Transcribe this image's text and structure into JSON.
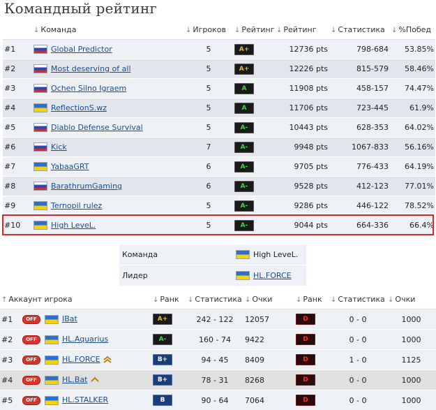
{
  "page": {
    "title": "Командный рейтинг"
  },
  "team_table": {
    "headers": {
      "team": "Команда",
      "players": "Игроков",
      "rating_badge": "Рейтинг",
      "rating": "Рейтинг",
      "stats": "Статистика",
      "win_pct": "%Побед"
    },
    "rows": [
      {
        "rank": "#1",
        "flag": "ru",
        "name": "Global Predictor",
        "players": "5",
        "badge": "A+",
        "badge_color": "gold",
        "rating": "12736 pts",
        "stats": "798-684",
        "win": "53.85%"
      },
      {
        "rank": "#2",
        "flag": "ru",
        "name": "Most deserving of all",
        "players": "5",
        "badge": "A+",
        "badge_color": "gold",
        "rating": "12226 pts",
        "stats": "815-579",
        "win": "58.46%"
      },
      {
        "rank": "#3",
        "flag": "ru",
        "name": "Ochen Silno Igraem",
        "players": "5",
        "badge": "A",
        "badge_color": "green",
        "rating": "11908 pts",
        "stats": "458-157",
        "win": "74.47%"
      },
      {
        "rank": "#4",
        "flag": "ua",
        "name": "ReflectionS.wz",
        "players": "5",
        "badge": "A",
        "badge_color": "green",
        "rating": "11706 pts",
        "stats": "723-445",
        "win": "61.9%"
      },
      {
        "rank": "#5",
        "flag": "ru",
        "name": "Diablo Defense Survival",
        "players": "5",
        "badge": "A-",
        "badge_color": "green",
        "rating": "10443 pts",
        "stats": "628-353",
        "win": "64.02%"
      },
      {
        "rank": "#6",
        "flag": "ru",
        "name": "Kick",
        "players": "7",
        "badge": "A-",
        "badge_color": "green",
        "rating": "9948 pts",
        "stats": "1067-833",
        "win": "56.16%"
      },
      {
        "rank": "#7",
        "flag": "ua",
        "name": "YabaaGRT",
        "players": "6",
        "badge": "A-",
        "badge_color": "green",
        "rating": "9705 pts",
        "stats": "776-433",
        "win": "64.19%"
      },
      {
        "rank": "#8",
        "flag": "ru",
        "name": "BarathrumGaming",
        "players": "6",
        "badge": "A-",
        "badge_color": "green",
        "rating": "9528 pts",
        "stats": "412-123",
        "win": "77.01%"
      },
      {
        "rank": "#9",
        "flag": "ua",
        "name": "Ternopil rulez",
        "players": "5",
        "badge": "A-",
        "badge_color": "green",
        "rating": "9286 pts",
        "stats": "446-122",
        "win": "78.52%"
      },
      {
        "rank": "#10",
        "flag": "ua",
        "name": "High LeveL.",
        "players": "5",
        "badge": "A-",
        "badge_color": "green",
        "rating": "9044 pts",
        "stats": "664-336",
        "win": "66.4%"
      }
    ]
  },
  "team_info": {
    "team_label": "Команда",
    "team_value": "High LeveL.",
    "team_flag": "ua",
    "leader_label": "Лидер",
    "leader_value": "HL.FORCE",
    "leader_flag": "ua"
  },
  "players_table": {
    "headers": {
      "account": "Аккаунт игрока",
      "rank1": "Ранк",
      "stats1": "Статистика",
      "points1": "Очки",
      "rank2": "Ранк",
      "stats2": "Статистика",
      "points2": "Очки"
    },
    "off_label": "OFF",
    "rows": [
      {
        "num": "#1",
        "name": "IBat",
        "chevrons": 0,
        "badge1": "A+",
        "badge1_color": "gold",
        "stats1": "242 - 122",
        "points1": "12057",
        "badge2": "D",
        "stats2": "0 - 0",
        "points2": "1000"
      },
      {
        "num": "#2",
        "name": "HL.Aquarius",
        "chevrons": 0,
        "badge1": "A-",
        "badge1_color": "green",
        "stats1": "160 - 74",
        "points1": "9422",
        "badge2": "D",
        "stats2": "0 - 0",
        "points2": "1000"
      },
      {
        "num": "#3",
        "name": "HL.FORCE",
        "chevrons": 2,
        "badge1": "B+",
        "badge1_color": "blue",
        "stats1": "94 - 45",
        "points1": "8409",
        "badge2": "D",
        "stats2": "1 - 0",
        "points2": "1125"
      },
      {
        "num": "#4",
        "name": "HL.Bat",
        "chevrons": 1,
        "badge1": "B+",
        "badge1_color": "blue",
        "stats1": "78 - 31",
        "points1": "8268",
        "badge2": "D",
        "stats2": "0 - 0",
        "points2": "1000"
      },
      {
        "num": "#5",
        "name": "HL.STALKER",
        "chevrons": 0,
        "badge1": "B",
        "badge1_color": "blue",
        "stats1": "90 - 64",
        "points1": "7064",
        "badge2": "D",
        "stats2": "0 - 0",
        "points2": "1000"
      }
    ]
  }
}
